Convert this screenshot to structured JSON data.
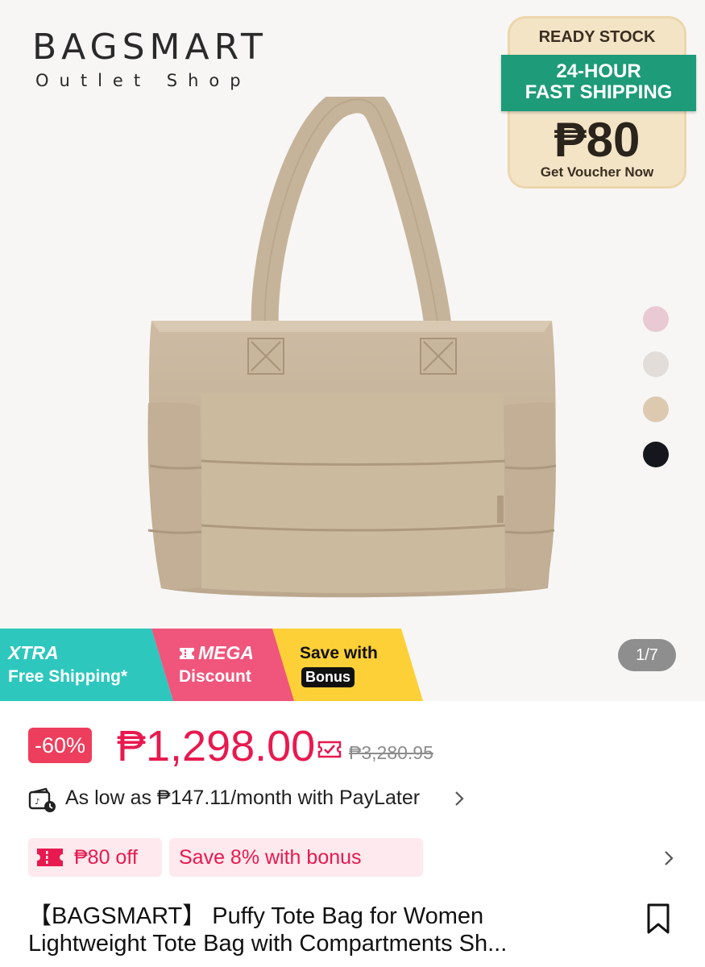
{
  "brand": {
    "name": "BAGSMART",
    "subtitle": "Outlet Shop"
  },
  "voucher_card": {
    "ready_label": "READY STOCK",
    "band_line1": "24-HOUR",
    "band_line2": "FAST SHIPPING",
    "amount": "₱80",
    "cta": "Get Voucher Now"
  },
  "colors": {
    "swatches": [
      "#e9c9d3",
      "#e2ddd8",
      "#dcc9b0",
      "#15171c"
    ],
    "price_red": "#e8194f",
    "voucher_green": "#1e9b79"
  },
  "promo_strip": {
    "xtra_top": "XTRA",
    "xtra_bottom": "Free Shipping*",
    "mega_top": "MEGA",
    "mega_bottom": "Discount",
    "bonus_top": "Save with",
    "bonus_bottom": "Bonus"
  },
  "gallery": {
    "pager": "1/7"
  },
  "price": {
    "discount": "-60%",
    "current": "₱1,298.00",
    "original": "₱3,280.95"
  },
  "paylater": {
    "text": "As low as ₱147.11/month with PayLater"
  },
  "vouchers": {
    "off_label": "₱80 off",
    "save_label": "Save 8% with bonus"
  },
  "product": {
    "title_line1": "【BAGSMART】 Puffy Tote Bag for Women",
    "title_line2": "Lightweight Tote Bag with Compartments Sh..."
  },
  "icons": {
    "coin": "price-guarantee-icon",
    "paylater": "paylater-icon",
    "ticket": "ticket-icon",
    "bookmark": "bookmark-icon",
    "chevron": "chevron-right-icon"
  }
}
